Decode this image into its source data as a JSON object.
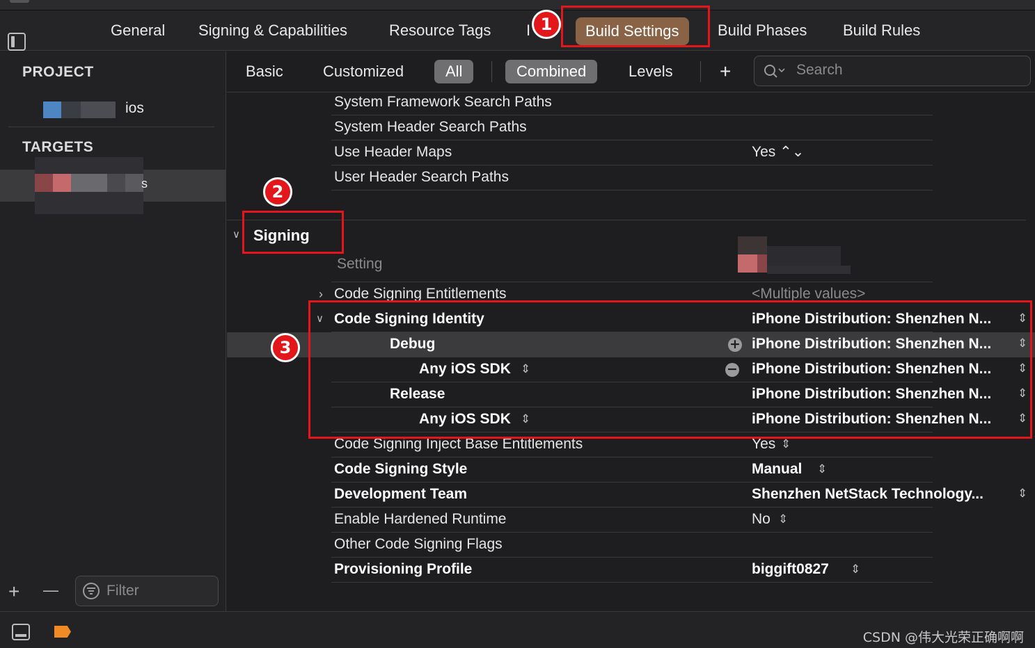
{
  "tabs": {
    "general": "General",
    "signing": "Signing & Capabilities",
    "resource_tags": "Resource Tags",
    "info_partial": "I",
    "build_settings": "Build Settings",
    "build_phases": "Build Phases",
    "build_rules": "Build Rules"
  },
  "sidebar": {
    "project_header": "PROJECT",
    "project_name_suffix": "ios",
    "targets_header": "TARGETS",
    "target_suffix": "s",
    "filter_placeholder": "Filter",
    "add": "+",
    "remove": "—"
  },
  "filterbar": {
    "basic": "Basic",
    "customized": "Customized",
    "all": "All",
    "combined": "Combined",
    "levels": "Levels",
    "add": "+",
    "search_placeholder": "Search"
  },
  "rows": [
    {
      "key": "System Framework Search Paths",
      "value": ""
    },
    {
      "key": "System Header Search Paths",
      "value": ""
    },
    {
      "key": "Use Header Maps",
      "value": "Yes ⌃⌄"
    },
    {
      "key": "User Header Search Paths",
      "value": ""
    }
  ],
  "signing": {
    "section_title": "Signing",
    "setting_label": "Setting",
    "entitlements": {
      "key": "Code Signing Entitlements",
      "value": "<Multiple values>"
    },
    "identity": {
      "key": "Code Signing Identity",
      "value": "iPhone Distribution: Shenzhen N..."
    },
    "debug": {
      "key": "Debug",
      "value": "iPhone Distribution: Shenzhen N..."
    },
    "debug_sdk": {
      "key": "Any iOS SDK",
      "value": "iPhone Distribution: Shenzhen N..."
    },
    "release": {
      "key": "Release",
      "value": "iPhone Distribution: Shenzhen N..."
    },
    "release_sdk": {
      "key": "Any iOS SDK",
      "value": "iPhone Distribution: Shenzhen N..."
    },
    "inject": {
      "key": "Code Signing Inject Base Entitlements",
      "value": "Yes"
    },
    "style": {
      "key": "Code Signing Style",
      "value": "Manual"
    },
    "team": {
      "key": "Development Team",
      "value": "Shenzhen NetStack Technology..."
    },
    "hardened": {
      "key": "Enable Hardened Runtime",
      "value": "No"
    },
    "other_flags": {
      "key": "Other Code Signing Flags",
      "value": ""
    },
    "profile": {
      "key": "Provisioning Profile",
      "value": "biggift0827"
    }
  },
  "annotations": {
    "one": "1",
    "two": "2",
    "three": "3"
  },
  "watermark": "CSDN @伟大光荣正确啊啊",
  "colors": {
    "active_tab": "#8a6347",
    "callout": "#e3161b",
    "selected_filter": "#6f6f72"
  }
}
